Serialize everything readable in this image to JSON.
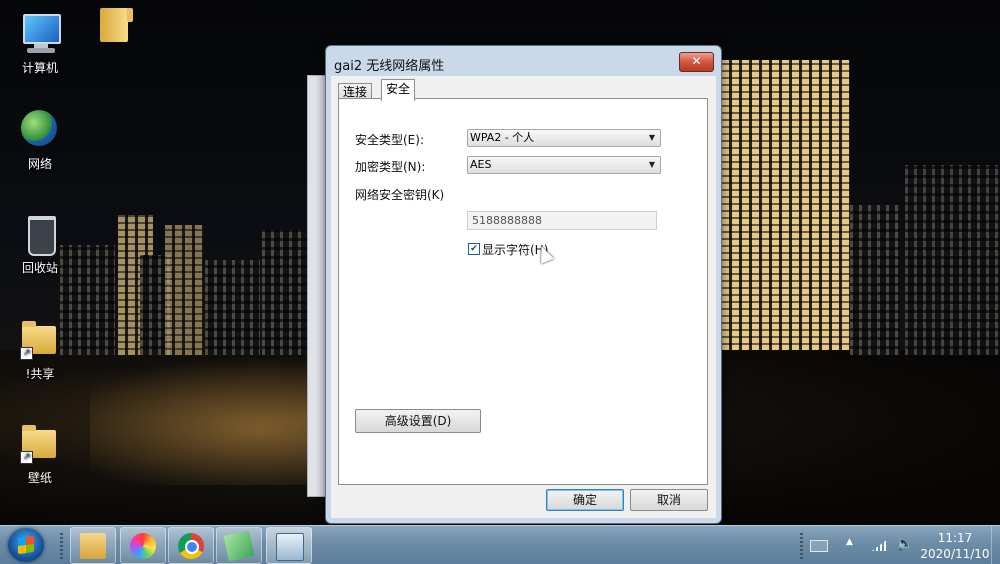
{
  "desktop": {
    "icons": [
      {
        "label": "计算机",
        "icon": "computer-icon"
      },
      {
        "label": "",
        "icon": "folder-icon"
      },
      {
        "label": "网络",
        "icon": "network-icon"
      },
      {
        "label": "回收站",
        "icon": "recycle-bin-icon"
      },
      {
        "label": "!共享",
        "icon": "folder-shortcut-icon"
      },
      {
        "label": "壁纸",
        "icon": "folder-shortcut-icon"
      }
    ]
  },
  "dialog": {
    "title": "gai2 无线网络属性",
    "close_glyph": "✕",
    "tabs": [
      {
        "label": "连接",
        "active": false
      },
      {
        "label": "安全",
        "active": true
      }
    ],
    "security_type": {
      "label": "安全类型(E):",
      "value": "WPA2 - 个人"
    },
    "encryption_type": {
      "label": "加密类型(N):",
      "value": "AES"
    },
    "network_key": {
      "label": "网络安全密钥(K)",
      "value": "5188888888"
    },
    "show_characters": {
      "label": "显示字符(H)",
      "checked": true
    },
    "advanced_button": "高级设置(D)",
    "ok_button": "确定",
    "cancel_button": "取消"
  },
  "taskbar": {
    "apps": [
      {
        "name": "explorer",
        "icon": "folder-icon"
      },
      {
        "name": "pinwheel-app",
        "icon": "pinwheel-icon"
      },
      {
        "name": "chrome",
        "icon": "chrome-icon"
      },
      {
        "name": "notes",
        "icon": "notes-icon"
      },
      {
        "name": "network-properties",
        "icon": "network-window-icon",
        "active": true
      }
    ],
    "clock": {
      "time": "11:17",
      "date": "2020/11/10"
    },
    "tray": {
      "arrow": "▲",
      "volume": "🔈"
    }
  },
  "colors": {
    "taskbar": "#6e8ea9",
    "dialog_frame": "#c9d9ea",
    "close_button": "#d0553f",
    "ok_focus": "#3c7fb1"
  }
}
